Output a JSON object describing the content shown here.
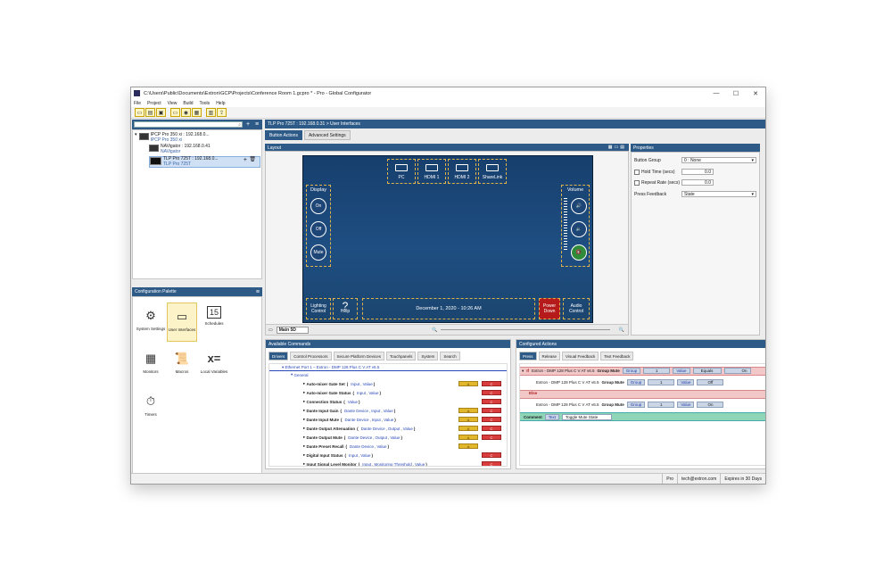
{
  "window": {
    "title": "C:\\Users\\Public\\Documents\\Extron\\GCP\\Projects\\Conference Room 1.gcpro * - Pro - Global Configurator",
    "controls": {
      "minimize": "—",
      "maximize": "☐",
      "close": "✕"
    }
  },
  "menu": [
    "File",
    "Project",
    "View",
    "Build",
    "Tools",
    "Help"
  ],
  "tree": {
    "search_icon": "⌕",
    "nodes": [
      {
        "name": "IPCP Pro 350 xi : 192.168.0...",
        "sub": "IPCP Pro 350 xi"
      },
      {
        "name": "NAVigator : 192.168.0.41",
        "sub": "NAVigator"
      },
      {
        "name": "TLP Pro 725T : 192.168.0...",
        "sub": "TLP Pro 725T"
      }
    ]
  },
  "palette": {
    "title": "Configuration Palette",
    "items": [
      "System Settings",
      "User Interfaces",
      "Schedules",
      "Monitors",
      "Macros",
      "Local Variables",
      "Timers"
    ]
  },
  "breadcrumb": "TLP Pro 725T : 192.168.0.31 > User Interfaces",
  "tabs": [
    "Button Actions",
    "Advanced Settings"
  ],
  "layout": {
    "title": "Layout",
    "sources": [
      "PC",
      "HDMI 1",
      "HDMI 2",
      "ShareLink"
    ],
    "display_label": "Display",
    "display_buttons": [
      "On",
      "Off",
      "Mute"
    ],
    "volume_label": "Volume",
    "bottom": {
      "lighting": "Lighting Control",
      "help": "Help",
      "datetime": "December 1, 2020 - 10:26 AM",
      "power": "Power Down",
      "audio": "Audio Control"
    },
    "page": "Main 5D"
  },
  "properties": {
    "title": "Properties",
    "button_group_label": "Button Group",
    "button_group_value": "0 : None",
    "hold_time_label": "Hold Time (secs)",
    "hold_time_value": "0.0",
    "repeat_rate_label": "Repeat Rate (secs)",
    "repeat_rate_value": "0.0",
    "press_feedback_label": "Press Feedback",
    "press_feedback_value": "State"
  },
  "commands": {
    "title": "Available Commands",
    "tabs": [
      "Drivers",
      "Control Processors",
      "Secure Platform Devices",
      "Touchpanels",
      "System",
      "Search"
    ],
    "header": "Ethernet Port 1 – Extron - DMP 128 Plus C V AT v6.5",
    "group": "General",
    "rows": [
      {
        "name": "Auto-mixer Gate Set",
        "params": [
          "Input",
          "Value"
        ],
        "a": true,
        "c": true
      },
      {
        "name": "Auto-mixer Gate Status",
        "params": [
          "Input",
          "Value"
        ],
        "a": false,
        "c": true
      },
      {
        "name": "Connection Status",
        "params": [
          "Value"
        ],
        "a": false,
        "c": true
      },
      {
        "name": "Dante Input Gain",
        "params": [
          "Dante Device",
          "Input",
          "Value"
        ],
        "a": true,
        "c": true
      },
      {
        "name": "Dante Input Mute",
        "params": [
          "Dante Device",
          "Input",
          "Value"
        ],
        "a": true,
        "c": true
      },
      {
        "name": "Dante Output Attenuation",
        "params": [
          "Dante Device",
          "Output",
          "Value"
        ],
        "a": true,
        "c": true
      },
      {
        "name": "Dante Output Mute",
        "params": [
          "Dante Device",
          "Output",
          "Value"
        ],
        "a": true,
        "c": true
      },
      {
        "name": "Dante Preset Recall",
        "params": [
          "Dante Device",
          "Value"
        ],
        "a": true,
        "c": false
      },
      {
        "name": "Digital Input Status",
        "params": [
          "Input",
          "Value"
        ],
        "a": false,
        "c": true
      },
      {
        "name": "Input Signal Level Monitor",
        "params": [
          "Input",
          "Monitoring Threshold",
          "Value"
        ],
        "a": false,
        "c": true
      }
    ],
    "a_label": "A",
    "c_label": "C"
  },
  "actions": {
    "title": "Configured Actions",
    "tabs": [
      "Press",
      "Release",
      "Visual Feedback",
      "Text Feedback"
    ],
    "if_row": {
      "kw": "If",
      "device": "Extron - DMP 128 Plus C V AT v6.5",
      "cmd": "Group Mute",
      "group": "Group",
      "num": "1",
      "value_label": "Value",
      "equals": "Equals",
      "on": "On"
    },
    "then_row": {
      "device": "Extron - DMP 128 Plus C V AT v6.5",
      "cmd": "Group Mute",
      "group": "Group",
      "num": "1",
      "value_label": "Value",
      "val": "Off"
    },
    "else_label": "Else",
    "else_row": {
      "device": "Extron - DMP 128 Plus C V AT v6.5",
      "cmd": "Group Mute",
      "group": "Group",
      "num": "1",
      "value_label": "Value",
      "val": "On"
    },
    "comment": {
      "kw": "Comment",
      "type": "Text",
      "text": "Toggle Mute State"
    }
  },
  "status": [
    "Pro",
    "tech@extron.com",
    "Expires in 30 Days"
  ]
}
